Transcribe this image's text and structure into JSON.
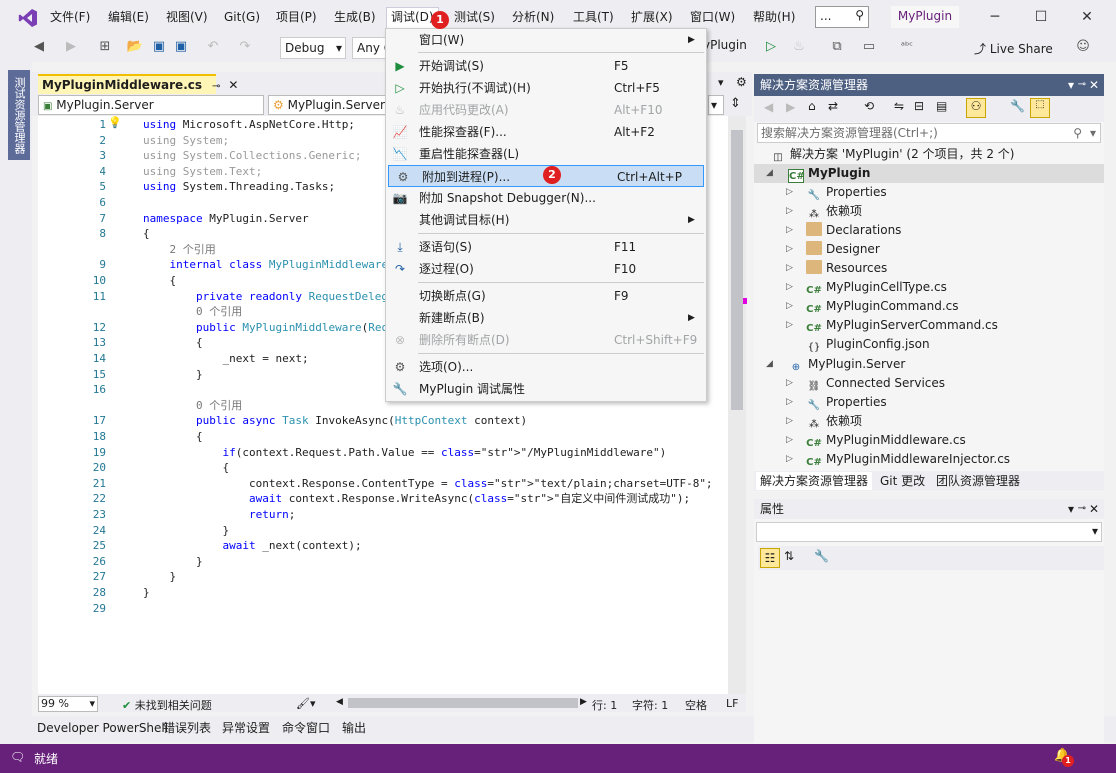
{
  "menubar": {
    "items": [
      "文件(F)",
      "编辑(E)",
      "视图(V)",
      "Git(G)",
      "项目(P)",
      "生成(B)",
      "调试(D)",
      "测试(S)",
      "分析(N)",
      "工具(T)",
      "扩展(X)",
      "窗口(W)",
      "帮助(H)"
    ],
    "search_value": "...",
    "solution_name": "MyPlugin"
  },
  "toolbar": {
    "config": "Debug",
    "platform": "Any C",
    "run_target": "yPlugin",
    "live_share": "Live Share"
  },
  "left_dock": {
    "tab_label": "测试资源管理器"
  },
  "editor": {
    "tab_title": "MyPluginMiddleware.cs",
    "nav_project": "MyPlugin.Server",
    "nav_type": "MyPlugin.Server.M",
    "lines": [
      {
        "n": "1",
        "t": "using Microsoft.AspNetCore.Http;"
      },
      {
        "n": "2",
        "t": "using System;"
      },
      {
        "n": "3",
        "t": "using System.Collections.Generic;"
      },
      {
        "n": "4",
        "t": "using System.Text;"
      },
      {
        "n": "5",
        "t": "using System.Threading.Tasks;"
      },
      {
        "n": "6",
        "t": ""
      },
      {
        "n": "7",
        "t": "namespace MyPlugin.Server"
      },
      {
        "n": "8",
        "t": "{"
      },
      {
        "n": "",
        "t": "    2 个引用"
      },
      {
        "n": "9",
        "t": "    internal class MyPluginMiddleware"
      },
      {
        "n": "10",
        "t": "    {"
      },
      {
        "n": "11",
        "t": "        private readonly RequestDelega"
      },
      {
        "n": "",
        "t": "        0 个引用"
      },
      {
        "n": "12",
        "t": "        public MyPluginMiddleware(Requ"
      },
      {
        "n": "13",
        "t": "        {"
      },
      {
        "n": "14",
        "t": "            _next = next;"
      },
      {
        "n": "15",
        "t": "        }"
      },
      {
        "n": "16",
        "t": ""
      },
      {
        "n": "",
        "t": "        0 个引用"
      },
      {
        "n": "17",
        "t": "        public async Task InvokeAsync(HttpContext context)"
      },
      {
        "n": "18",
        "t": "        {"
      },
      {
        "n": "19",
        "t": "            if(context.Request.Path.Value == \"/MyPluginMiddleware\")"
      },
      {
        "n": "20",
        "t": "            {"
      },
      {
        "n": "21",
        "t": "                context.Response.ContentType = \"text/plain;charset=UTF-8\";"
      },
      {
        "n": "22",
        "t": "                await context.Response.WriteAsync(\"自定义中间件测试成功\");"
      },
      {
        "n": "23",
        "t": "                return;"
      },
      {
        "n": "24",
        "t": "            }"
      },
      {
        "n": "25",
        "t": "            await _next(context);"
      },
      {
        "n": "26",
        "t": "        }"
      },
      {
        "n": "27",
        "t": "    }"
      },
      {
        "n": "28",
        "t": "}"
      },
      {
        "n": "29",
        "t": ""
      }
    ],
    "zoom": "99 %",
    "issues": "未找到相关问题",
    "line_label": "行: 1",
    "char_label": "字符: 1",
    "whitespace": "空格",
    "line_ending": "LF"
  },
  "debug_menu": {
    "items": [
      {
        "label": "窗口(W)",
        "shortcut": "",
        "disabled": false
      },
      {
        "label": "开始调试(S)",
        "shortcut": "F5",
        "disabled": false
      },
      {
        "label": "开始执行(不调试)(H)",
        "shortcut": "Ctrl+F5",
        "disabled": false
      },
      {
        "label": "应用代码更改(A)",
        "shortcut": "Alt+F10",
        "disabled": true
      },
      {
        "label": "性能探查器(F)...",
        "shortcut": "Alt+F2",
        "disabled": false
      },
      {
        "label": "重启性能探查器(L)",
        "shortcut": "",
        "disabled": false
      },
      {
        "label": "附加到进程(P)...",
        "shortcut": "Ctrl+Alt+P",
        "disabled": false
      },
      {
        "label": "附加 Snapshot Debugger(N)...",
        "shortcut": "",
        "disabled": false
      },
      {
        "label": "其他调试目标(H)",
        "shortcut": "",
        "disabled": false
      },
      {
        "label": "逐语句(S)",
        "shortcut": "F11",
        "disabled": false
      },
      {
        "label": "逐过程(O)",
        "shortcut": "F10",
        "disabled": false
      },
      {
        "label": "切换断点(G)",
        "shortcut": "F9",
        "disabled": false
      },
      {
        "label": "新建断点(B)",
        "shortcut": "",
        "disabled": false
      },
      {
        "label": "删除所有断点(D)",
        "shortcut": "Ctrl+Shift+F9",
        "disabled": true
      },
      {
        "label": "选项(O)...",
        "shortcut": "",
        "disabled": false
      },
      {
        "label": "MyPlugin 调试属性",
        "shortcut": "",
        "disabled": false
      }
    ],
    "step_badges": [
      "1",
      "2"
    ]
  },
  "solution_explorer": {
    "title": "解决方案资源管理器",
    "search_placeholder": "搜索解决方案资源管理器(Ctrl+;)",
    "solution": "解决方案 'MyPlugin' (2 个项目，共 2 个)",
    "project1": "MyPlugin",
    "project1_items": [
      "Properties",
      "依赖项",
      "Declarations",
      "Designer",
      "Resources",
      "MyPluginCellType.cs",
      "MyPluginCommand.cs",
      "MyPluginServerCommand.cs",
      "PluginConfig.json"
    ],
    "project2": "MyPlugin.Server",
    "project2_items": [
      "Connected Services",
      "Properties",
      "依赖项",
      "MyPluginMiddleware.cs",
      "MyPluginMiddlewareInjector.cs"
    ],
    "tabs": [
      "解决方案资源管理器",
      "Git 更改",
      "团队资源管理器"
    ]
  },
  "properties": {
    "title": "属性"
  },
  "bottom_tabs": [
    "Developer PowerShell",
    "错误列表",
    "异常设置",
    "命令窗口",
    "输出"
  ],
  "status": {
    "text": "就绪",
    "notifications": "1"
  },
  "colors": {
    "accent": "#68217a",
    "highlight": "#c9def5",
    "badge": "#e02020"
  }
}
